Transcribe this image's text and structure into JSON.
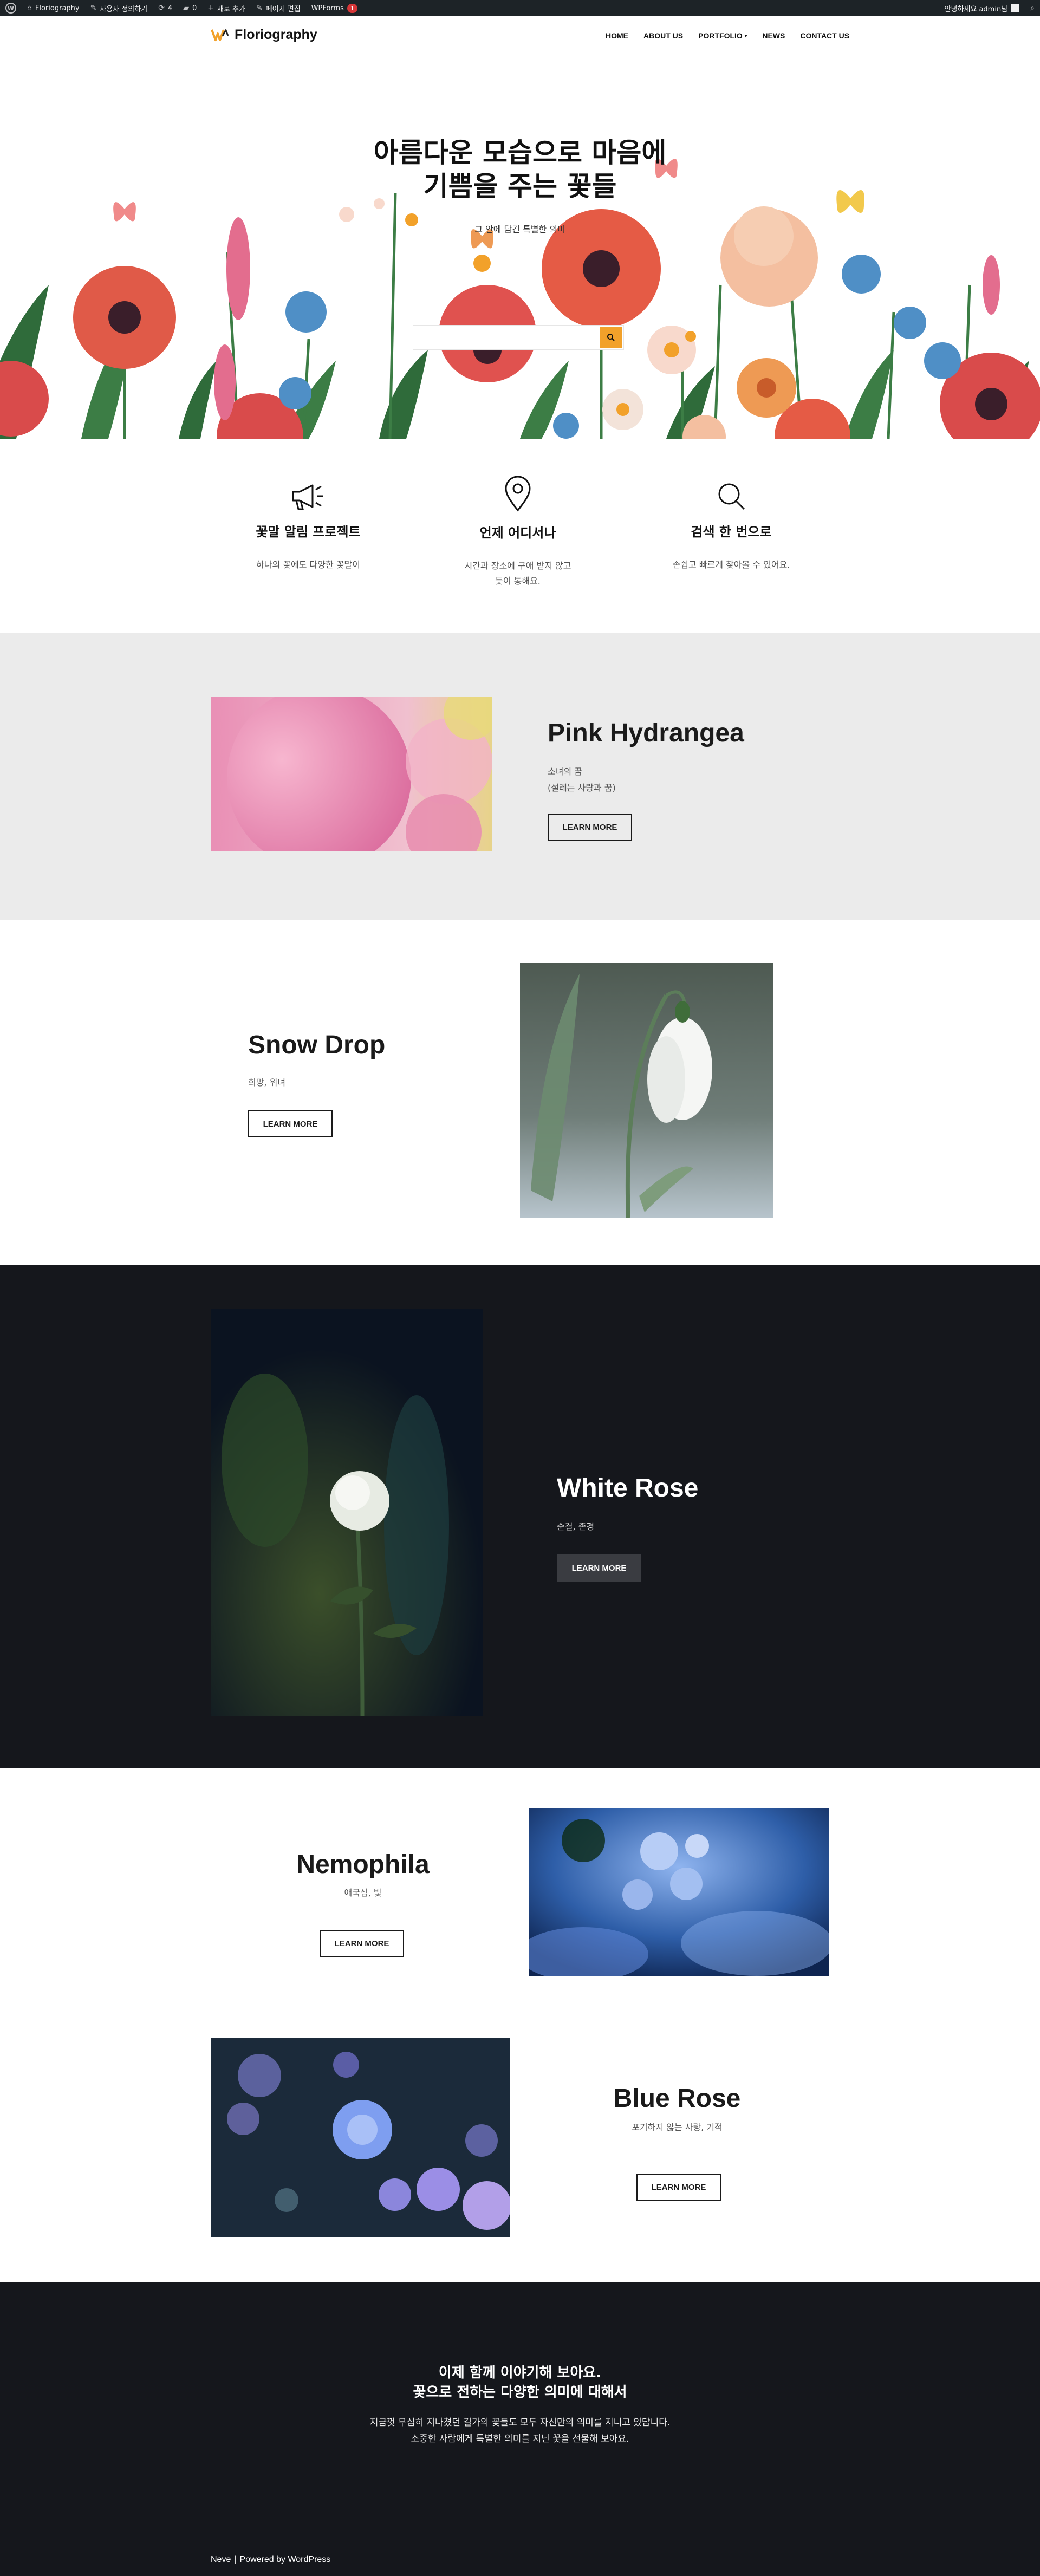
{
  "admin_bar": {
    "site_name": "Floriography",
    "customize": "사용자 정의하기",
    "updates_count": "4",
    "comments_count": "0",
    "new_label": "새로 추가",
    "edit_page": "페이지 편집",
    "wpforms_label": "WPForms",
    "wpforms_badge": "1",
    "greeting": "안녕하세요 admin님"
  },
  "header": {
    "logo_text": "Floriography",
    "nav": [
      "HOME",
      "ABOUT US",
      "PORTFOLIO",
      "NEWS",
      "CONTACT US"
    ]
  },
  "hero": {
    "title_line1": "아름다운 모습으로 마음에",
    "title_line2": "기쁨을 주는 꽃들",
    "subtitle": "그 안에 담긴 특별한 의미",
    "search_value": ""
  },
  "features": [
    {
      "icon": "megaphone-icon",
      "title": "꽃말 알림 프로젝트",
      "text": "하나의 꽃에도 다양한 꽃말이"
    },
    {
      "icon": "location-pin-icon",
      "title": "언제 어디서나",
      "text_line1": "시간과 장소에 구애 받지 않고",
      "text_line2": "듯이 통해요."
    },
    {
      "icon": "search-icon",
      "title": "검색 한 번으로",
      "text": "손쉽고 빠르게 찾아볼 수 있어요."
    }
  ],
  "flowers": {
    "hydrangea": {
      "title": "Pink Hydrangea",
      "line1": "소녀의 꿈",
      "line2": "(설레는 사랑과 꿈)",
      "button": "LEARN MORE"
    },
    "snowdrop": {
      "title": "Snow Drop",
      "text": "희망, 위녀",
      "button": "LEARN MORE"
    },
    "white_rose": {
      "title": "White Rose",
      "text": "순결, 존경",
      "button": "LEARN MORE"
    },
    "nemophila": {
      "title": "Nemophila",
      "text": "애국심, 빛",
      "button": "LEARN MORE"
    },
    "blue_rose": {
      "title": "Blue Rose",
      "text": "포기하지 않는 사랑, 기적",
      "button": "LEARN MORE"
    }
  },
  "cta": {
    "title_line1": "이제 함께 이야기해 보아요.",
    "title_line2": "꽃으로 전하는 다양한 의미에 대해서",
    "text_line1": "지금껏 무심히 지나쳤던 길가의 꽃들도 모두 자신만의 의미를 지니고 있답니다.",
    "text_line2": "소중한 사람에게 특별한 의미를 지닌 꽃을 선물해 보아요."
  },
  "footer": {
    "theme": "Neve",
    "separator": "|",
    "powered": "Powered by WordPress"
  },
  "colors": {
    "accent": "#f2a12a",
    "dark": "#15171c",
    "light_gray": "#ebebeb"
  }
}
